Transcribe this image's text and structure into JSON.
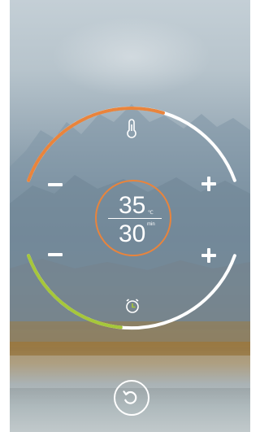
{
  "temperature": {
    "value": "35",
    "unit": "℃",
    "level_fraction": 0.62,
    "color": "#e9843c",
    "icon": "thermometer-icon"
  },
  "timer": {
    "value": "30",
    "unit": "min",
    "level_fraction": 0.46,
    "color": "#a6c73a",
    "icon": "alarm-clock-icon"
  },
  "controls": {
    "decrease_symbol": "minus-icon",
    "increase_symbol": "plus-icon",
    "back_icon": "return-icon"
  }
}
